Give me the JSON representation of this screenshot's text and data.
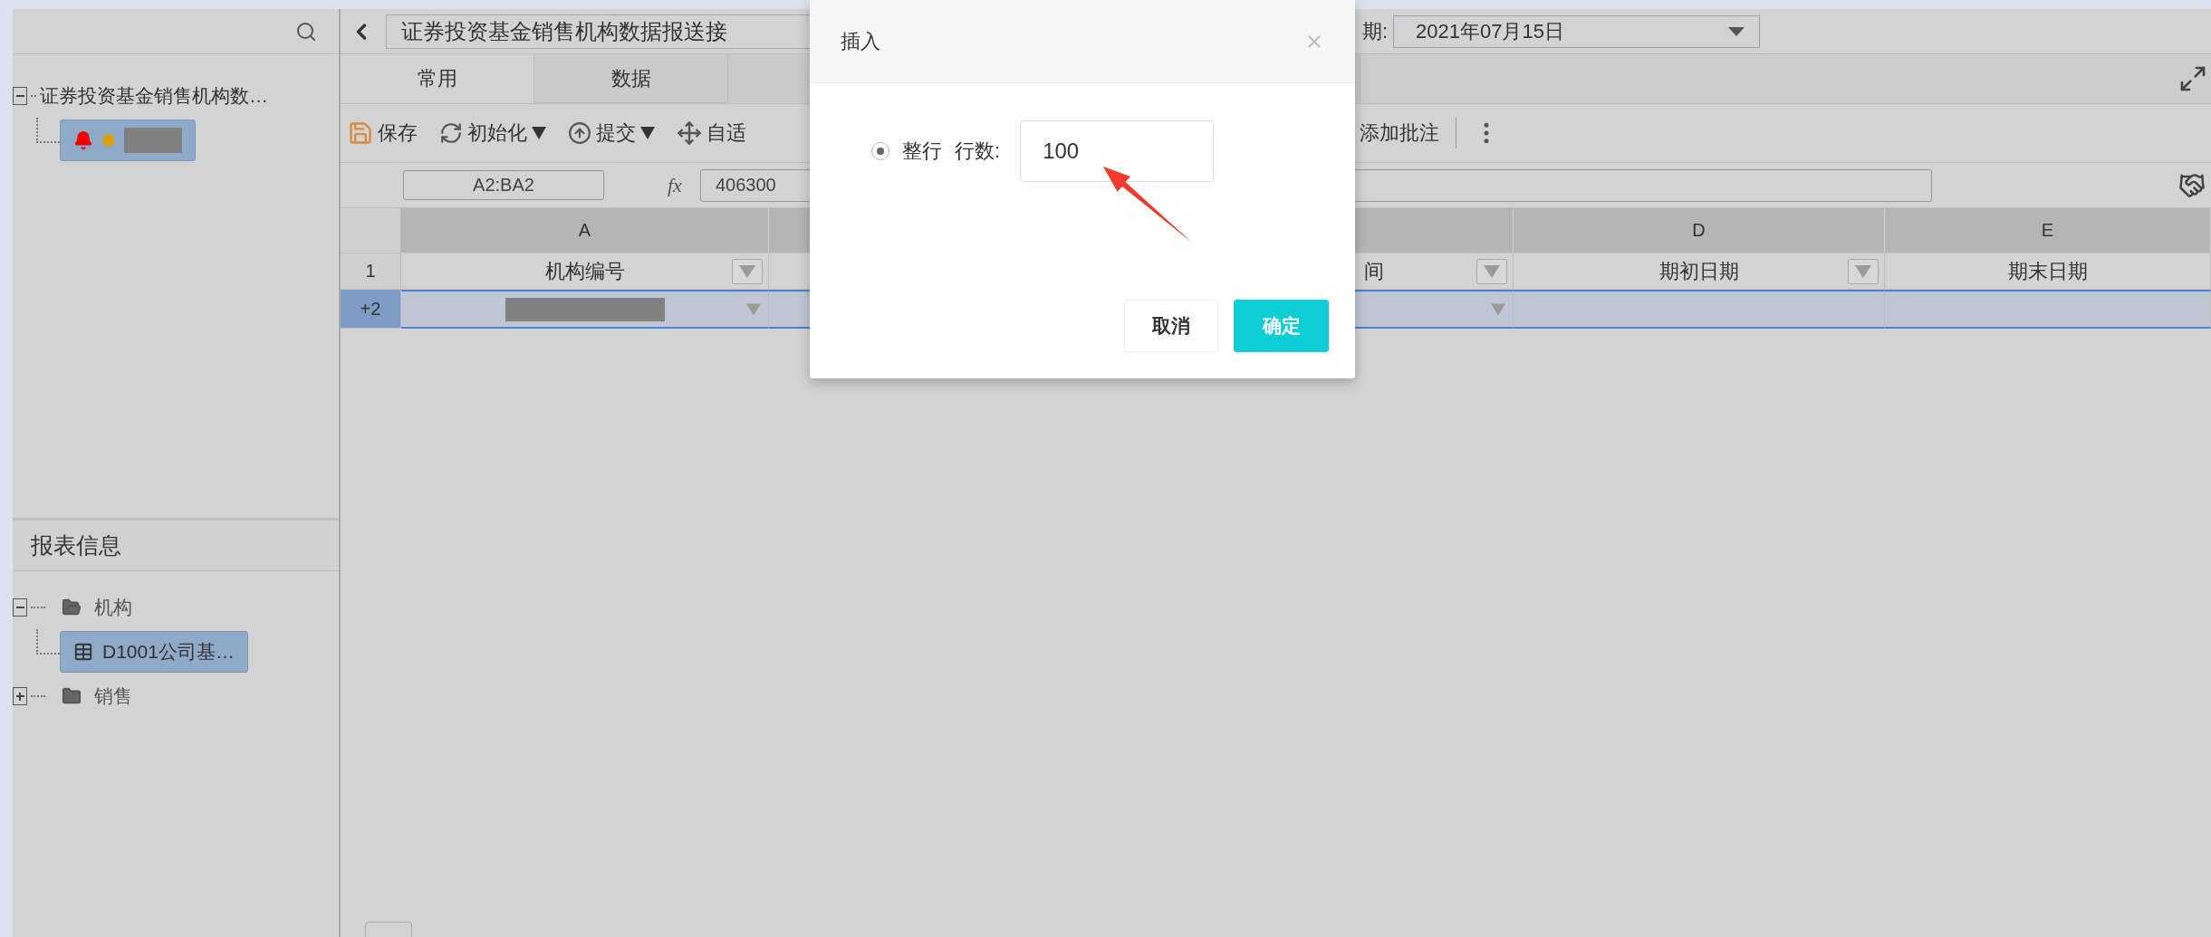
{
  "sidebar": {
    "tree": [
      {
        "kind": "report",
        "label": "证券投资基金销售机构数…",
        "expanded": true,
        "children": [
          {
            "kind": "task",
            "redacted": true,
            "selected": true
          }
        ]
      }
    ]
  },
  "report_info": {
    "title": "报表信息",
    "tree": [
      {
        "kind": "folder",
        "label": "机构",
        "expanded": true,
        "children": [
          {
            "kind": "sheet",
            "label": "D1001公司基…",
            "selected": true
          }
        ]
      },
      {
        "kind": "folder",
        "label": "销售",
        "expanded": false
      }
    ]
  },
  "topbar": {
    "report_title": "证券投资基金销售机构数据报送接",
    "date_label": "期:",
    "date": "2021年07月15日"
  },
  "tabs": [
    {
      "label": "常用",
      "selected": true
    },
    {
      "label": "数据",
      "selected": false
    }
  ],
  "toolbar": {
    "left": [
      {
        "label": "保存",
        "dropdown": false
      },
      {
        "label": "初始化",
        "dropdown": true
      },
      {
        "label": "提交",
        "dropdown": true
      },
      {
        "label": "自适",
        "dropdown": false
      }
    ],
    "right": [
      {
        "label": "添加批注"
      }
    ]
  },
  "formula_bar": {
    "cell_ref": "A2:BA2",
    "fx": "fx",
    "value": "406300"
  },
  "grid": {
    "columns": [
      {
        "letter": "A",
        "title": "机构编号",
        "filter": true
      },
      {
        "title": "间",
        "filter": true
      },
      {
        "letter": "D",
        "title": "期初日期",
        "filter": true
      },
      {
        "letter": "E",
        "title": "期末日期",
        "filter": false
      }
    ],
    "rows": [
      {
        "number": "1",
        "selected": false,
        "kind": "header"
      },
      {
        "number": "+2",
        "selected": true,
        "kind": "data",
        "cells": [
          {
            "redacted": true,
            "dropdown": true
          },
          {
            "redacted": false,
            "dropdown": true
          },
          {
            "redacted": false,
            "dropdown": false
          },
          {
            "redacted": false,
            "dropdown": false
          }
        ]
      }
    ]
  },
  "dialog": {
    "title": "插入",
    "option": {
      "label": "整行",
      "selected": true
    },
    "rows_label": "行数:",
    "rows_value": "100",
    "buttons": [
      {
        "label": "取消",
        "kind": "secondary"
      },
      {
        "label": "确定",
        "kind": "primary"
      }
    ]
  }
}
